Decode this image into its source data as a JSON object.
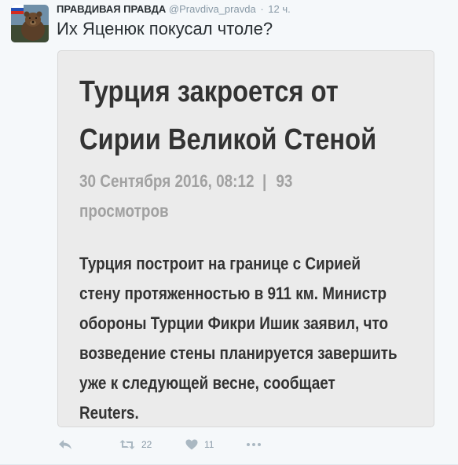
{
  "tweet": {
    "fullname": "ПРАВДИВАЯ ПРАВДА",
    "username": "@Pravdiva_pravda",
    "separator": "·",
    "timestamp": "12 ч.",
    "text": "Их Яценюк покусал чтоле?"
  },
  "card": {
    "headline_line1": "Турция закроется от",
    "headline_line2": "Сирии Великой Стеной",
    "date": "30 Сентября 2016, 08:12",
    "pipe": "|",
    "views_count": "93",
    "views_label": "просмотров",
    "body": [
      "Турция построит на границе с Сирией",
      "стену протяженностью в 911 км. Министр",
      "обороны Турции Фикри Ишик заявил, что",
      "возведение стены планируется завершить",
      "уже к следующей весне, сообщает",
      "Reuters."
    ]
  },
  "actions": {
    "reply_icon": "reply-icon",
    "retweet_icon": "retweet-icon",
    "retweet_count": "22",
    "like_icon": "heart-icon",
    "like_count": "11",
    "more_icon": "more-dots-icon"
  },
  "colors": {
    "background": "#f5f8fa",
    "card_background": "#ebebeb",
    "text_primary": "#292f33",
    "text_muted": "#8899a6",
    "card_headline": "#333333",
    "card_meta": "#a1a1a1"
  }
}
